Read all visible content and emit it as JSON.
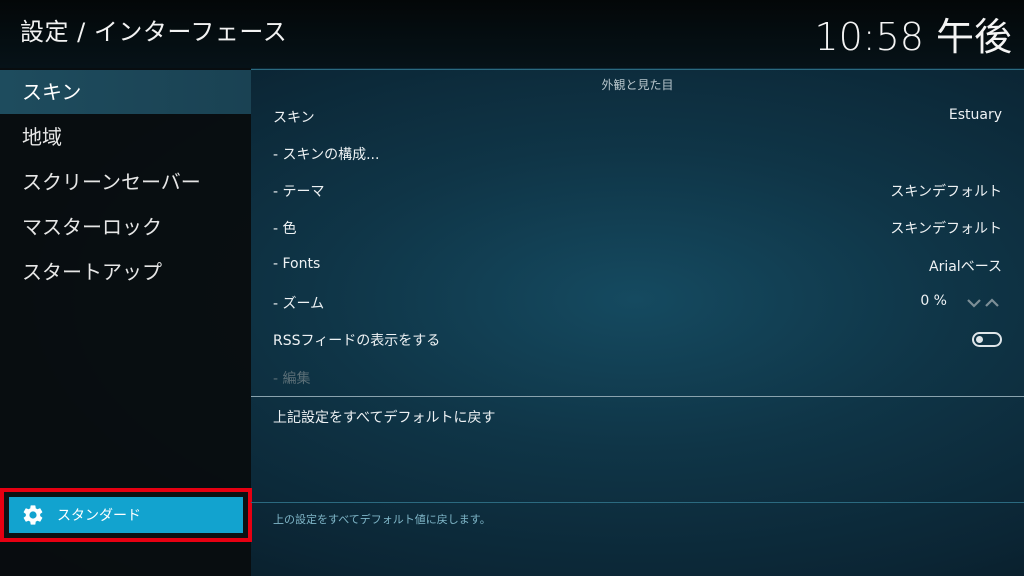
{
  "header": {
    "title": "設定 / インターフェース",
    "clock": "10:58 午後"
  },
  "sidebar": {
    "items": [
      {
        "label": "スキン"
      },
      {
        "label": "地域"
      },
      {
        "label": "スクリーンセーバー"
      },
      {
        "label": "マスターロック"
      },
      {
        "label": "スタートアップ"
      }
    ],
    "active_index": 0,
    "level_button": {
      "label": "スタンダード",
      "icon": "gear-icon"
    }
  },
  "main": {
    "section_title": "外観と見た目",
    "rows": [
      {
        "label": "スキン",
        "value": "Estuary"
      },
      {
        "label": "- スキンの構成...",
        "value": ""
      },
      {
        "label": "- テーマ",
        "value": "スキンデフォルト"
      },
      {
        "label": "- 色",
        "value": "スキンデフォルト"
      },
      {
        "label": "- Fonts",
        "value": "Arialベース"
      },
      {
        "label": "- ズーム",
        "value": "0 %"
      },
      {
        "label": "RSSフィードの表示をする",
        "toggle_on": false
      },
      {
        "label": "- 編集",
        "disabled": true
      }
    ],
    "reset_label": "上記設定をすべてデフォルトに戻す",
    "footer_help": "上の設定をすべてデフォルト値に戻します。"
  },
  "colors": {
    "accent": "#12a3cf",
    "highlight_box": "#e60012",
    "sidebar_active": "#1e4c5e"
  }
}
